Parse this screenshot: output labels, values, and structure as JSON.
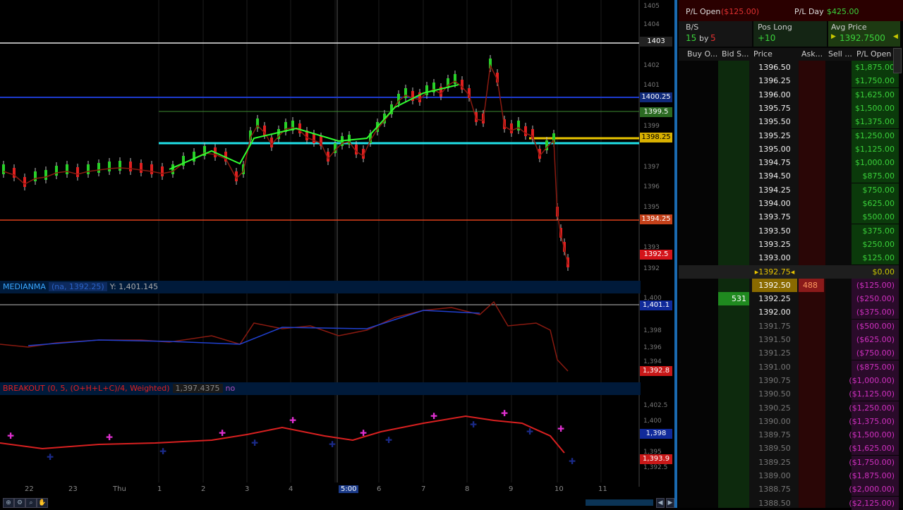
{
  "chart": {
    "price_ticks": [
      "1405",
      "1404",
      "1402",
      "1401",
      "1399",
      "1397",
      "1396",
      "1395",
      "1393",
      "1392"
    ],
    "level_tags": [
      {
        "label": "1403",
        "bg": "#222",
        "fg": "#fff"
      },
      {
        "label": "1400.25",
        "bg": "#102a7a",
        "fg": "#fff"
      },
      {
        "label": "1399.5",
        "bg": "#2b6a22",
        "fg": "#fff"
      },
      {
        "label": "1398.25",
        "bg": "#d8b000",
        "fg": "#000"
      },
      {
        "label": "1394.25",
        "bg": "#c4411a",
        "fg": "#fff"
      },
      {
        "label": "1392.5",
        "bg": "#d4141a",
        "fg": "#fff"
      }
    ],
    "median_study": {
      "name": "MEDIANMA",
      "params": "(na, 1392.25)",
      "y_readout": "Y: 1,401.145",
      "tag_top": "1,401.1",
      "tag_bottom": "1,392.8",
      "ticks": [
        "1,400",
        "1,398",
        "1,396",
        "1,394"
      ]
    },
    "breakout_study": {
      "name": "BREAKOUT (0, 5, (O+H+L+C)/4, Weighted)",
      "value": "1,397.4375",
      "extra": "no",
      "tag_top": "1,398",
      "tag_bottom": "1,393.9",
      "ticks": [
        "1,402.5",
        "1,400",
        "1,395",
        "1,392.5"
      ]
    },
    "x_ticks": [
      "22",
      "23",
      "Thu",
      "1",
      "2",
      "3",
      "4",
      "5:00",
      "6",
      "7",
      "8",
      "9",
      "10",
      "11"
    ]
  },
  "dom": {
    "pl_open_label": "P/L Open",
    "pl_open_value": "($125.00)",
    "pl_day_label": "P/L Day",
    "pl_day_value": "$425.00",
    "bs_label": "B/S",
    "bs_value_a": "15",
    "bs_by": "by",
    "bs_value_b": "5",
    "pos_label": "Pos Long",
    "pos_value": "+10",
    "avg_label": "Avg Price",
    "avg_value": "1392.7500",
    "columns": [
      "Buy O...",
      "Bid S...",
      "Price",
      "Ask...",
      "Sell ...",
      "P/L Open"
    ],
    "rows": [
      {
        "price": "1396.50",
        "pl": "$1,875.00",
        "bid": "",
        "ask": ""
      },
      {
        "price": "1396.25",
        "pl": "$1,750.00",
        "bid": "",
        "ask": ""
      },
      {
        "price": "1396.00",
        "pl": "$1,625.00",
        "bid": "",
        "ask": ""
      },
      {
        "price": "1395.75",
        "pl": "$1,500.00",
        "bid": "",
        "ask": ""
      },
      {
        "price": "1395.50",
        "pl": "$1,375.00",
        "bid": "",
        "ask": ""
      },
      {
        "price": "1395.25",
        "pl": "$1,250.00",
        "bid": "",
        "ask": ""
      },
      {
        "price": "1395.00",
        "pl": "$1,125.00",
        "bid": "",
        "ask": ""
      },
      {
        "price": "1394.75",
        "pl": "$1,000.00",
        "bid": "",
        "ask": ""
      },
      {
        "price": "1394.50",
        "pl": "$875.00",
        "bid": "",
        "ask": ""
      },
      {
        "price": "1394.25",
        "pl": "$750.00",
        "bid": "",
        "ask": ""
      },
      {
        "price": "1394.00",
        "pl": "$625.00",
        "bid": "",
        "ask": ""
      },
      {
        "price": "1393.75",
        "pl": "$500.00",
        "bid": "",
        "ask": ""
      },
      {
        "price": "1393.50",
        "pl": "$375.00",
        "bid": "",
        "ask": ""
      },
      {
        "price": "1393.25",
        "pl": "$250.00",
        "bid": "",
        "ask": ""
      },
      {
        "price": "1393.00",
        "pl": "$125.00",
        "bid": "",
        "ask": ""
      },
      {
        "price": "1392.75",
        "pl": "$0.00",
        "bid": "",
        "ask": ""
      },
      {
        "price": "1392.50",
        "pl": "($125.00)",
        "bid": "",
        "ask": "488"
      },
      {
        "price": "1392.25",
        "pl": "($250.00)",
        "bid": "531",
        "ask": ""
      },
      {
        "price": "1392.00",
        "pl": "($375.00)",
        "bid": "",
        "ask": ""
      },
      {
        "price": "1391.75",
        "pl": "($500.00)",
        "bid": "",
        "ask": ""
      },
      {
        "price": "1391.50",
        "pl": "($625.00)",
        "bid": "",
        "ask": ""
      },
      {
        "price": "1391.25",
        "pl": "($750.00)",
        "bid": "",
        "ask": ""
      },
      {
        "price": "1391.00",
        "pl": "($875.00)",
        "bid": "",
        "ask": ""
      },
      {
        "price": "1390.75",
        "pl": "($1,000.00)",
        "bid": "",
        "ask": ""
      },
      {
        "price": "1390.50",
        "pl": "($1,125.00)",
        "bid": "",
        "ask": ""
      },
      {
        "price": "1390.25",
        "pl": "($1,250.00)",
        "bid": "",
        "ask": ""
      },
      {
        "price": "1390.00",
        "pl": "($1,375.00)",
        "bid": "",
        "ask": ""
      },
      {
        "price": "1389.75",
        "pl": "($1,500.00)",
        "bid": "",
        "ask": ""
      },
      {
        "price": "1389.50",
        "pl": "($1,625.00)",
        "bid": "",
        "ask": ""
      },
      {
        "price": "1389.25",
        "pl": "($1,750.00)",
        "bid": "",
        "ask": ""
      },
      {
        "price": "1389.00",
        "pl": "($1,875.00)",
        "bid": "",
        "ask": ""
      },
      {
        "price": "1388.75",
        "pl": "($2,000.00)",
        "bid": "",
        "ask": ""
      },
      {
        "price": "1388.50",
        "pl": "($2,125.00)",
        "bid": "",
        "ask": ""
      }
    ],
    "avg_row_index": 15
  }
}
